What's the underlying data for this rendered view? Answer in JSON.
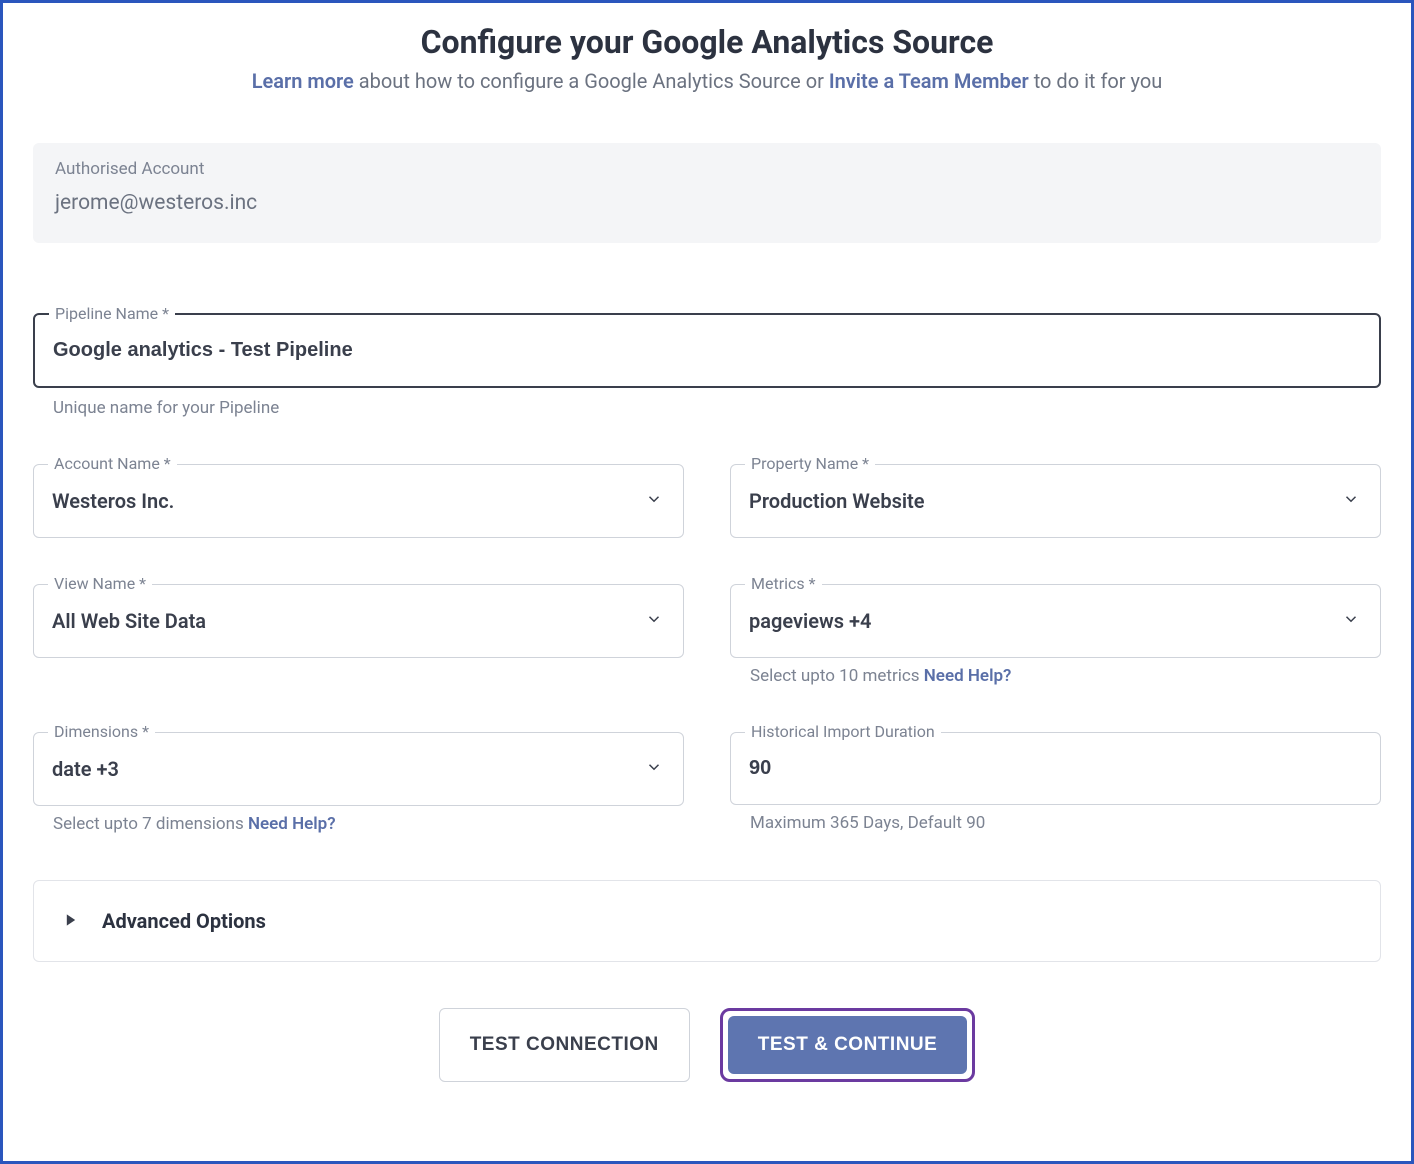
{
  "header": {
    "title": "Configure your Google Analytics Source",
    "learn_more": "Learn more",
    "subtitle_mid": " about how to configure a Google Analytics Source or ",
    "invite_link": "Invite a Team Member",
    "subtitle_end": " to do it for you"
  },
  "account": {
    "label": "Authorised Account",
    "value": "jerome@westeros.inc"
  },
  "pipeline": {
    "label": "Pipeline Name *",
    "value": "Google analytics - Test Pipeline",
    "hint": "Unique name for your Pipeline"
  },
  "account_name": {
    "label": "Account Name *",
    "value": "Westeros Inc."
  },
  "property_name": {
    "label": "Property Name *",
    "value": "Production Website"
  },
  "view_name": {
    "label": "View Name *",
    "value": "All Web Site Data"
  },
  "metrics": {
    "label": "Metrics *",
    "value": "pageviews +4",
    "hint_prefix": "Select upto 10 metrics ",
    "help": "Need Help?"
  },
  "dimensions": {
    "label": "Dimensions *",
    "value": "date +3",
    "hint_prefix": "Select upto 7 dimensions ",
    "help": "Need Help?"
  },
  "historical": {
    "label": "Historical Import Duration",
    "value": "90",
    "hint": "Maximum 365 Days, Default 90"
  },
  "advanced": {
    "label": "Advanced Options"
  },
  "buttons": {
    "test_connection": "TEST CONNECTION",
    "test_continue": "TEST & CONTINUE"
  }
}
